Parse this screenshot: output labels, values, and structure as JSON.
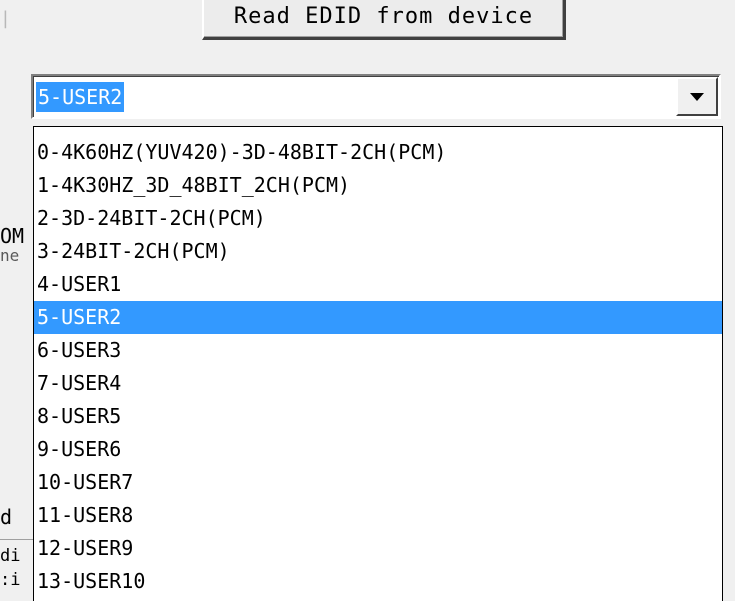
{
  "read_button": {
    "label": "Read EDID from device"
  },
  "side_fragments": {
    "tick": "|",
    "om": "OM",
    "ne": "ne",
    "d": "d",
    "di": "di",
    "dots": ":i"
  },
  "combo": {
    "value": "5-USER2"
  },
  "dropdown": {
    "selected_index": 5,
    "options": [
      "0-4K60HZ(YUV420)-3D-48BIT-2CH(PCM)",
      "1-4K30HZ_3D_48BIT_2CH(PCM)",
      "2-3D-24BIT-2CH(PCM)",
      "3-24BIT-2CH(PCM)",
      "4-USER1",
      "5-USER2",
      "6-USER3",
      "7-USER4",
      "8-USER5",
      "9-USER6",
      "10-USER7",
      "11-USER8",
      "12-USER9",
      "13-USER10"
    ]
  },
  "colors": {
    "selection": "#3399ff",
    "window_bg": "#f0f0f0"
  }
}
